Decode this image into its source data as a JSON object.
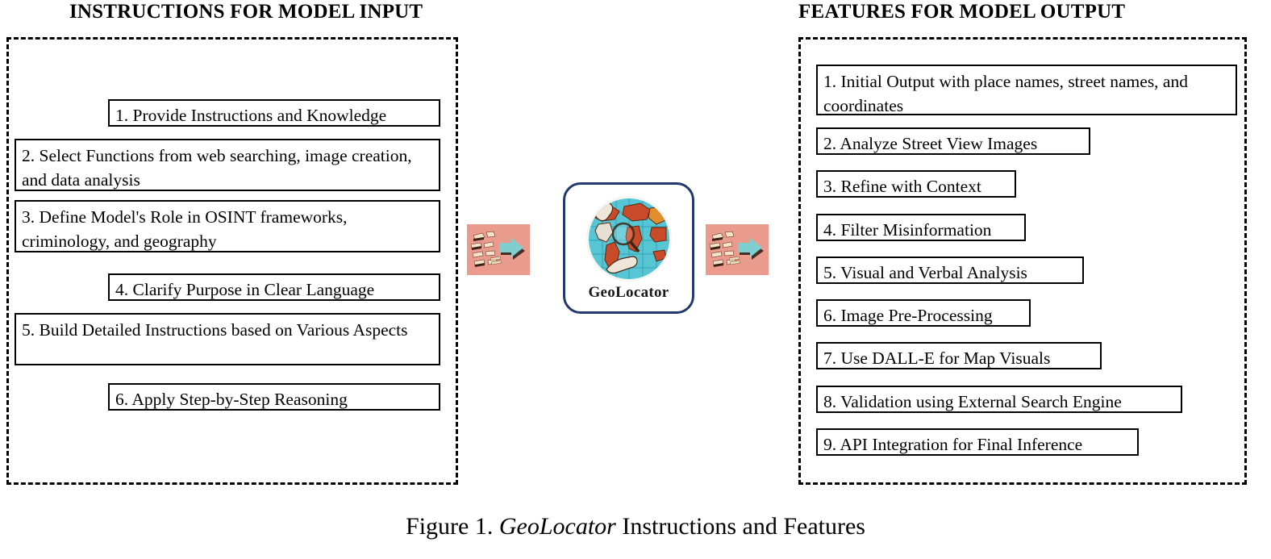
{
  "figure": {
    "caption_prefix": "Figure 1. ",
    "caption_emphasis": "GeoLocator",
    "caption_suffix": " Instructions and Features"
  },
  "left_panel": {
    "header": "INSTRUCTIONS FOR MODEL INPUT",
    "items": [
      {
        "number": "1.",
        "text": "1. Provide Instructions and Knowledge"
      },
      {
        "number": "2.",
        "text": "2. Select Functions from web searching, image creation, and data analysis"
      },
      {
        "number": "3.",
        "text": "3. Define Model's Role in OSINT frameworks, criminology, and geography"
      },
      {
        "number": "4.",
        "text": "4. Clarify Purpose in Clear Language"
      },
      {
        "number": "5.",
        "text": "5. Build Detailed Instructions based on Various Aspects"
      },
      {
        "number": "6.",
        "text": "6. Apply Step-by-Step Reasoning"
      }
    ]
  },
  "right_panel": {
    "header": "FEATURES FOR MODEL OUTPUT",
    "items": [
      {
        "number": "1.",
        "text": "1. Initial Output with place names, street names, and coordinates"
      },
      {
        "number": "2.",
        "text": "2. Analyze Street View Images"
      },
      {
        "number": "3.",
        "text": "3. Refine with Context"
      },
      {
        "number": "4.",
        "text": "4. Filter Misinformation"
      },
      {
        "number": "5.",
        "text": "5. Visual and Verbal Analysis"
      },
      {
        "number": "6.",
        "text": "6. Image Pre-Processing"
      },
      {
        "number": "7.",
        "text": "7. Use DALL-E for Map Visuals"
      },
      {
        "number": "8.",
        "text": "8. Validation using External Search Engine"
      },
      {
        "number": "9.",
        "text": "9. API Integration for Final Inference"
      }
    ]
  },
  "center": {
    "logo_label": "GeoLocator",
    "arrow_left_name": "input-flow-arrow",
    "arrow_right_name": "output-flow-arrow"
  },
  "colors": {
    "logo_border": "#22386e",
    "arrow_tile_background": "#eb9a8e",
    "arrow_body": "#7fcfd0",
    "globe_ocean": "#57c6d4",
    "globe_land": "#d9552f",
    "panel_border": "#000000",
    "box_border": "#000000",
    "text": "#000000"
  }
}
